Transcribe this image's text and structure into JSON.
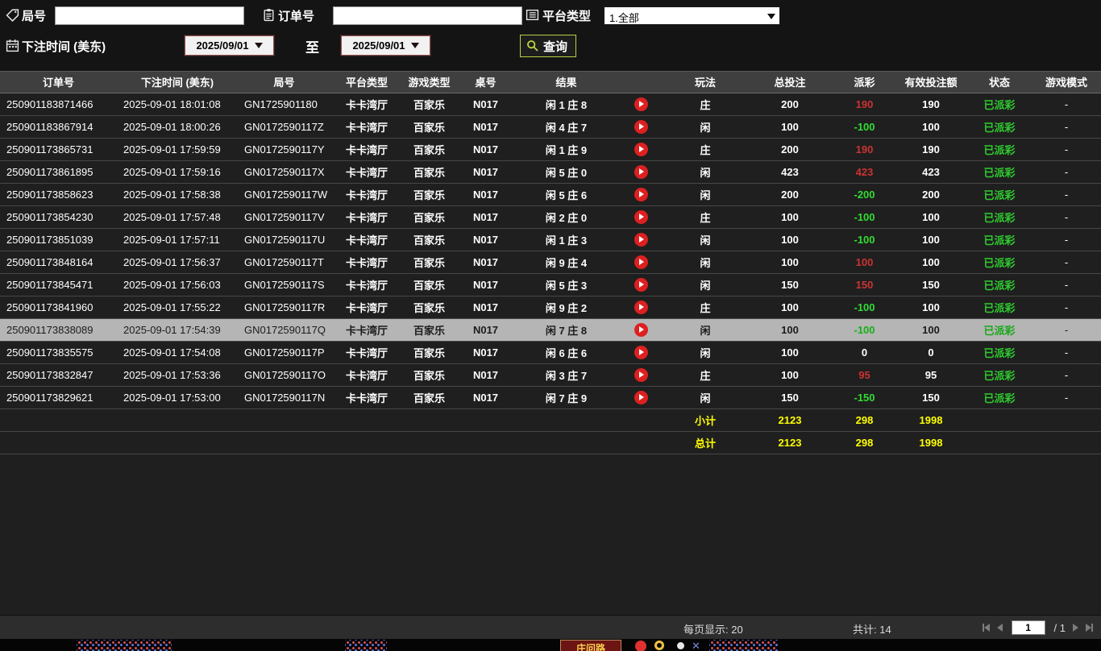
{
  "colors": {
    "positive_payout": "#cc3333",
    "negative_payout": "#33dd33",
    "status_paid": "#2fcc2f",
    "summary_text": "#ffff00",
    "query_border": "#b9d043",
    "selected_row_bg": "#b5b5b5"
  },
  "filters": {
    "round_label": "局号",
    "round_value": "",
    "order_label": "订单号",
    "order_value": "",
    "platform_label": "平台类型",
    "platform_value": "1.全部",
    "bet_time_label": "下注时间 (美东)",
    "date_from": "2025/09/01",
    "to_label": "至",
    "date_to": "2025/09/01",
    "query_label": "查询"
  },
  "table": {
    "columns": [
      "订单号",
      "下注时间 (美东)",
      "局号",
      "平台类型",
      "游戏类型",
      "桌号",
      "结果",
      "",
      "玩法",
      "总投注",
      "派彩",
      "有效投注额",
      "状态",
      "游戏模式"
    ],
    "selected_index": 10,
    "rows": [
      {
        "order_no": "250901183871466",
        "bet_time": "2025-09-01 18:01:08",
        "round_no": "GN1725901180",
        "platform": "卡卡湾厅",
        "game_type": "百家乐",
        "table_no": "N017",
        "result": "闲 1 庄 8",
        "play": "庄",
        "total_bet": "200",
        "payout": "190",
        "valid_bet": "190",
        "status": "已派彩",
        "mode": "-"
      },
      {
        "order_no": "250901183867914",
        "bet_time": "2025-09-01 18:00:26",
        "round_no": "GN0172590117Z",
        "platform": "卡卡湾厅",
        "game_type": "百家乐",
        "table_no": "N017",
        "result": "闲 4 庄 7",
        "play": "闲",
        "total_bet": "100",
        "payout": "-100",
        "valid_bet": "100",
        "status": "已派彩",
        "mode": "-"
      },
      {
        "order_no": "250901173865731",
        "bet_time": "2025-09-01 17:59:59",
        "round_no": "GN0172590117Y",
        "platform": "卡卡湾厅",
        "game_type": "百家乐",
        "table_no": "N017",
        "result": "闲 1 庄 9",
        "play": "庄",
        "total_bet": "200",
        "payout": "190",
        "valid_bet": "190",
        "status": "已派彩",
        "mode": "-"
      },
      {
        "order_no": "250901173861895",
        "bet_time": "2025-09-01 17:59:16",
        "round_no": "GN0172590117X",
        "platform": "卡卡湾厅",
        "game_type": "百家乐",
        "table_no": "N017",
        "result": "闲 5 庄 0",
        "play": "闲",
        "total_bet": "423",
        "payout": "423",
        "valid_bet": "423",
        "status": "已派彩",
        "mode": "-"
      },
      {
        "order_no": "250901173858623",
        "bet_time": "2025-09-01 17:58:38",
        "round_no": "GN0172590117W",
        "platform": "卡卡湾厅",
        "game_type": "百家乐",
        "table_no": "N017",
        "result": "闲 5 庄 6",
        "play": "闲",
        "total_bet": "200",
        "payout": "-200",
        "valid_bet": "200",
        "status": "已派彩",
        "mode": "-"
      },
      {
        "order_no": "250901173854230",
        "bet_time": "2025-09-01 17:57:48",
        "round_no": "GN0172590117V",
        "platform": "卡卡湾厅",
        "game_type": "百家乐",
        "table_no": "N017",
        "result": "闲 2 庄 0",
        "play": "庄",
        "total_bet": "100",
        "payout": "-100",
        "valid_bet": "100",
        "status": "已派彩",
        "mode": "-"
      },
      {
        "order_no": "250901173851039",
        "bet_time": "2025-09-01 17:57:11",
        "round_no": "GN0172590117U",
        "platform": "卡卡湾厅",
        "game_type": "百家乐",
        "table_no": "N017",
        "result": "闲 1 庄 3",
        "play": "闲",
        "total_bet": "100",
        "payout": "-100",
        "valid_bet": "100",
        "status": "已派彩",
        "mode": "-"
      },
      {
        "order_no": "250901173848164",
        "bet_time": "2025-09-01 17:56:37",
        "round_no": "GN0172590117T",
        "platform": "卡卡湾厅",
        "game_type": "百家乐",
        "table_no": "N017",
        "result": "闲 9 庄 4",
        "play": "闲",
        "total_bet": "100",
        "payout": "100",
        "valid_bet": "100",
        "status": "已派彩",
        "mode": "-"
      },
      {
        "order_no": "250901173845471",
        "bet_time": "2025-09-01 17:56:03",
        "round_no": "GN0172590117S",
        "platform": "卡卡湾厅",
        "game_type": "百家乐",
        "table_no": "N017",
        "result": "闲 5 庄 3",
        "play": "闲",
        "total_bet": "150",
        "payout": "150",
        "valid_bet": "150",
        "status": "已派彩",
        "mode": "-"
      },
      {
        "order_no": "250901173841960",
        "bet_time": "2025-09-01 17:55:22",
        "round_no": "GN0172590117R",
        "platform": "卡卡湾厅",
        "game_type": "百家乐",
        "table_no": "N017",
        "result": "闲 9 庄 2",
        "play": "庄",
        "total_bet": "100",
        "payout": "-100",
        "valid_bet": "100",
        "status": "已派彩",
        "mode": "-"
      },
      {
        "order_no": "250901173838089",
        "bet_time": "2025-09-01 17:54:39",
        "round_no": "GN0172590117Q",
        "platform": "卡卡湾厅",
        "game_type": "百家乐",
        "table_no": "N017",
        "result": "闲 7 庄 8",
        "play": "闲",
        "total_bet": "100",
        "payout": "-100",
        "valid_bet": "100",
        "status": "已派彩",
        "mode": "-"
      },
      {
        "order_no": "250901173835575",
        "bet_time": "2025-09-01 17:54:08",
        "round_no": "GN0172590117P",
        "platform": "卡卡湾厅",
        "game_type": "百家乐",
        "table_no": "N017",
        "result": "闲 6 庄 6",
        "play": "闲",
        "total_bet": "100",
        "payout": "0",
        "valid_bet": "0",
        "status": "已派彩",
        "mode": "-"
      },
      {
        "order_no": "250901173832847",
        "bet_time": "2025-09-01 17:53:36",
        "round_no": "GN0172590117O",
        "platform": "卡卡湾厅",
        "game_type": "百家乐",
        "table_no": "N017",
        "result": "闲 3 庄 7",
        "play": "庄",
        "total_bet": "100",
        "payout": "95",
        "valid_bet": "95",
        "status": "已派彩",
        "mode": "-"
      },
      {
        "order_no": "250901173829621",
        "bet_time": "2025-09-01 17:53:00",
        "round_no": "GN0172590117N",
        "platform": "卡卡湾厅",
        "game_type": "百家乐",
        "table_no": "N017",
        "result": "闲 7 庄 9",
        "play": "闲",
        "total_bet": "150",
        "payout": "-150",
        "valid_bet": "150",
        "status": "已派彩",
        "mode": "-"
      }
    ],
    "subtotal": {
      "label": "小计",
      "total_bet": "2123",
      "payout": "298",
      "valid_bet": "1998"
    },
    "total": {
      "label": "总计",
      "total_bet": "2123",
      "payout": "298",
      "valid_bet": "1998"
    }
  },
  "footer": {
    "page_size_label": "每页显示: 20",
    "total_count_label": "共计: 14",
    "page_value": "1",
    "page_total_label": "/  1"
  },
  "background_fragment": {
    "label": "庄问路"
  }
}
